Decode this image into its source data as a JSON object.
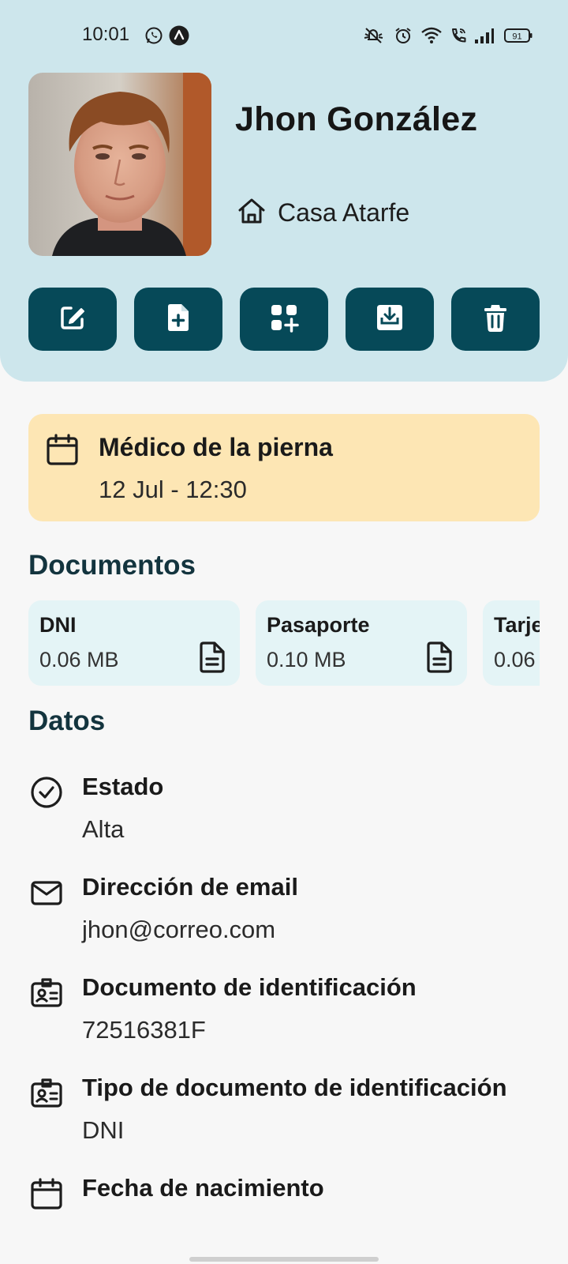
{
  "status_bar": {
    "time": "10:01",
    "battery": "91",
    "icons": [
      "whatsapp-icon",
      "app-notification-icon",
      "mute-icon",
      "alarm-icon",
      "wifi-icon",
      "wifi-calling-icon",
      "signal-icon",
      "battery-icon"
    ]
  },
  "profile": {
    "name": "Jhon González",
    "location": "Casa Atarfe",
    "location_icon": "home-icon"
  },
  "actions": [
    {
      "icon": "edit-icon"
    },
    {
      "icon": "add-file-icon"
    },
    {
      "icon": "add-widget-icon"
    },
    {
      "icon": "download-icon"
    },
    {
      "icon": "trash-icon"
    }
  ],
  "appointment": {
    "title": "Médico de la pierna",
    "datetime": "12 Jul - 12:30",
    "icon": "calendar-icon"
  },
  "documents": {
    "title": "Documentos",
    "items": [
      {
        "name": "DNI",
        "size": "0.06 MB"
      },
      {
        "name": "Pasaporte",
        "size": "0.10 MB"
      },
      {
        "name": "Tarje",
        "size": "0.06"
      }
    ]
  },
  "datos": {
    "title": "Datos",
    "fields": [
      {
        "icon": "check-circle-icon",
        "label": "Estado",
        "value": "Alta"
      },
      {
        "icon": "mail-icon",
        "label": "Dirección de email",
        "value": "jhon@correo.com"
      },
      {
        "icon": "id-card-icon",
        "label": "Documento de identificación",
        "value": "72516381F"
      },
      {
        "icon": "id-card-icon",
        "label": "Tipo de documento de identificación",
        "value": "DNI"
      },
      {
        "icon": "calendar-icon",
        "label": "Fecha de nacimiento",
        "value": ""
      }
    ]
  },
  "colors": {
    "header_bg": "#cde6ec",
    "action_bg": "#064958",
    "appointment_bg": "#fde6b4",
    "doc_card_bg": "#e4f4f6",
    "section_title": "#13343e"
  }
}
